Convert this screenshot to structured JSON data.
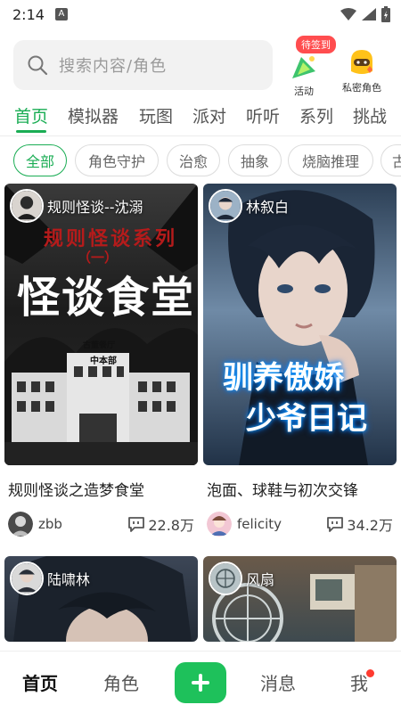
{
  "status_bar": {
    "time": "2:14",
    "notification_icon": "A"
  },
  "header": {
    "search_placeholder": "搜索内容/角色",
    "activity_label": "活动",
    "activity_badge": "待签到",
    "secret_role_label": "私密角色"
  },
  "main_tabs": [
    "首页",
    "模拟器",
    "玩图",
    "派对",
    "听听",
    "系列",
    "挑战"
  ],
  "filter_chips": [
    "全部",
    "角色守护",
    "治愈",
    "抽象",
    "烧脑推理",
    "古"
  ],
  "cards": [
    {
      "author": "规则怪谈--沈溺",
      "cover_top_text": "规则怪谈系列",
      "cover_sub_text": "（一）",
      "cover_main_text": "怪谈食堂",
      "cover_sign_text": "古董餐厅",
      "cover_tag_text": "中本部",
      "title": "规则怪谈之造梦食堂",
      "user": "zbb",
      "count": "22.8万"
    },
    {
      "author": "林叙白",
      "cover_line1": "驯养傲娇",
      "cover_line2": "少爷日记",
      "title": "泡面、球鞋与初次交锋",
      "user": "felicity",
      "count": "34.2万"
    },
    {
      "author": "陆啸林"
    },
    {
      "author": "风扇"
    }
  ],
  "bottom_nav": {
    "home": "首页",
    "role": "角色",
    "messages": "消息",
    "me": "我"
  },
  "colors": {
    "accent": "#1aad54",
    "badge": "#ff4d4f",
    "add_button": "#1ec15b"
  }
}
